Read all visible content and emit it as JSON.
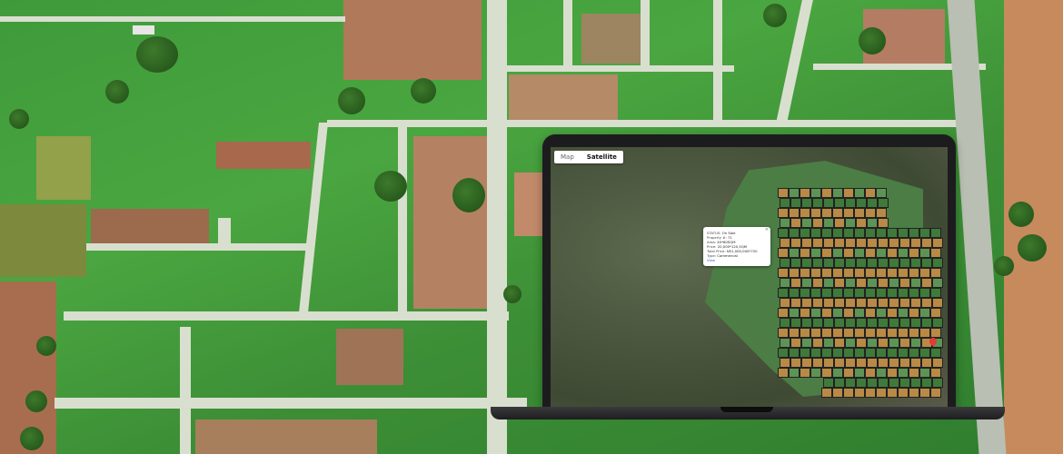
{
  "map": {
    "tabs": [
      {
        "label": "Map",
        "active": false
      },
      {
        "label": "Satellite",
        "active": true
      }
    ]
  },
  "popup": {
    "close_symbol": "×",
    "status_label": "STATUS:",
    "status_value": "On Sale",
    "property_label": "Property #:",
    "property_value": "71",
    "area_label": "Area:",
    "area_value": "40*60SQM",
    "price_label": "Price:",
    "price_value": "20,000*120,5QM",
    "total_label": "Total Price:",
    "total_value": "N51,000,000*720",
    "type_label": "Type:",
    "type_value": "Commercial",
    "link_label": "View"
  },
  "colors": {
    "lot_green": "#3f7a3a",
    "lot_orange": "#b88a45",
    "marker": "#e53935",
    "field_green": "#4aa640"
  },
  "icons": {
    "marker": "map-pin-icon",
    "close": "close-icon"
  }
}
